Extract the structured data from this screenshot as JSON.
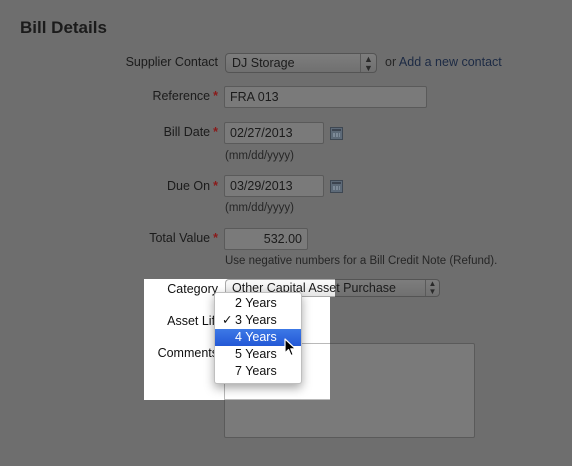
{
  "section": {
    "title": "Bill Details"
  },
  "supplier": {
    "label": "Supplier Contact",
    "value": "DJ Storage",
    "or_text": "or",
    "add_link": "Add a new contact"
  },
  "reference": {
    "label": "Reference",
    "value": "FRA 013",
    "required": "*"
  },
  "bill_date": {
    "label": "Bill Date",
    "value": "02/27/2013",
    "hint": "(mm/dd/yyyy)",
    "required": "*"
  },
  "due_on": {
    "label": "Due On",
    "value": "03/29/2013",
    "hint": "(mm/dd/yyyy)",
    "required": "*"
  },
  "total_value": {
    "label": "Total Value",
    "value": "532.00",
    "hint": "Use negative numbers for a Bill Credit Note (Refund).",
    "required": "*"
  },
  "category": {
    "label": "Category",
    "value": "Other Capital Asset Purchase"
  },
  "asset_life": {
    "label": "Asset Life",
    "options": [
      "2 Years",
      "3 Years",
      "4 Years",
      "5 Years",
      "7 Years"
    ],
    "checked": "3 Years",
    "hovered": "4 Years",
    "check_mark": "✓"
  },
  "comments": {
    "label": "Comments",
    "value": ""
  },
  "icons": {
    "calendar": "calendar-icon",
    "select_arrows": "updown-arrows-icon",
    "cursor": "pointer-cursor-icon"
  }
}
